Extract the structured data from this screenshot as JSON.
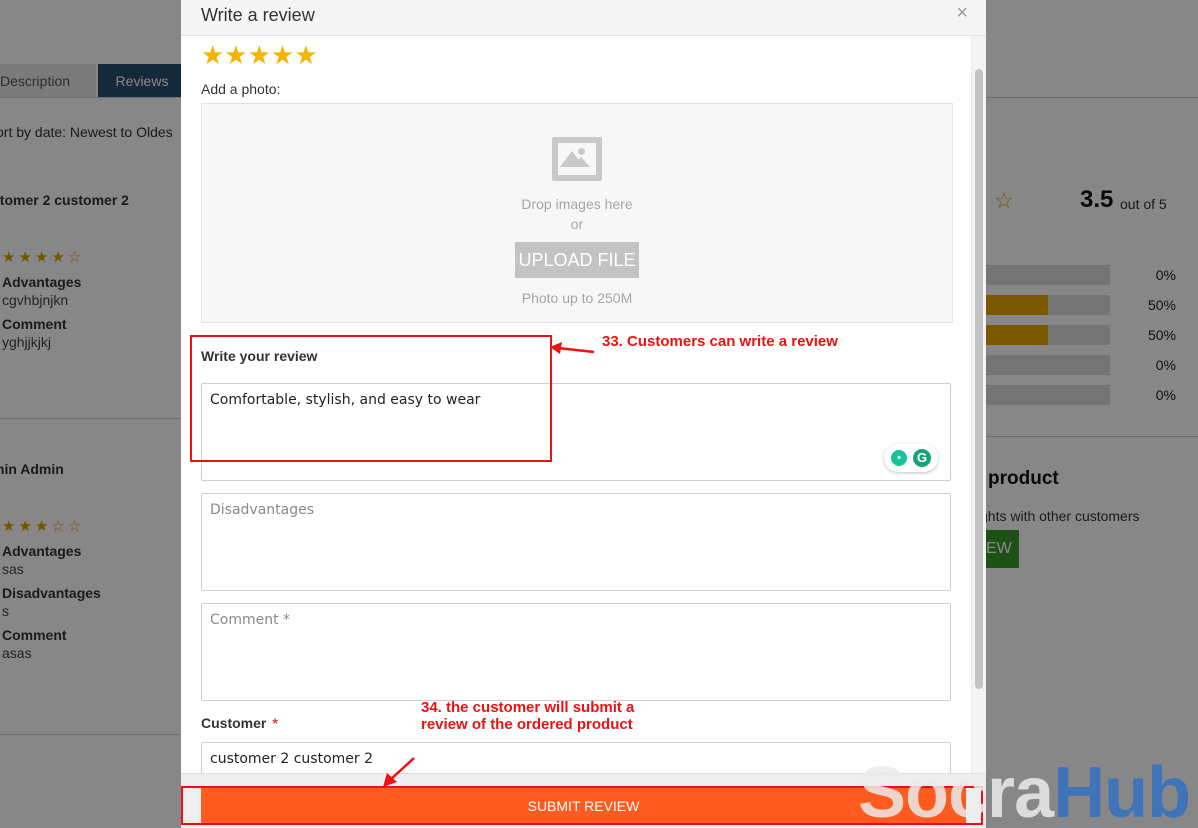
{
  "background": {
    "tabs": [
      "Description",
      "Reviews"
    ],
    "sort_label": "ort by date: Newest to Oldes",
    "reviews": [
      {
        "name": "stomer 2 customer 2",
        "rating": 4,
        "stars": "★★★★☆",
        "fields": [
          {
            "label": "Advantages",
            "value": "cgvhbjnjkn"
          },
          {
            "label": "Comment",
            "value": "yghjjkjkj"
          }
        ]
      },
      {
        "name": "min Admin",
        "rating": 3,
        "stars": "★★★☆☆",
        "fields": [
          {
            "label": "Advantages",
            "value": "sas"
          },
          {
            "label": "Disadvantages",
            "value": "s"
          },
          {
            "label": "Comment",
            "value": "asas"
          }
        ]
      }
    ],
    "summary": {
      "star_icon": "☆",
      "score": "3.5",
      "out_of": "out of 5",
      "bars": [
        {
          "pct": "0%",
          "fill": 0
        },
        {
          "pct": "50%",
          "fill": 0.5
        },
        {
          "pct": "50%",
          "fill": 0.5
        },
        {
          "pct": "0%",
          "fill": 0
        },
        {
          "pct": "0%",
          "fill": 0
        }
      ]
    },
    "product_heading": "product",
    "share_text": "ghts with other customers",
    "green_button": "EW"
  },
  "modal": {
    "title": "Write a review",
    "close": "×",
    "rating": 5,
    "stars": "★★★★★",
    "photo_label": "Add a photo:",
    "dropzone": {
      "drop_text": "Drop images here",
      "or_text": "or",
      "upload_label": "UPLOAD FILE",
      "limit_text": "Photo up to 250M"
    },
    "review_label": "Write your review",
    "review_value": "Comfortable, stylish, and easy to wear",
    "disadvantages_placeholder": "Disadvantages",
    "comment_placeholder": "Comment *",
    "customer_label": "Customer",
    "customer_required": "*",
    "customer_value": "customer 2 customer 2",
    "submit_label": "SUBMIT REVIEW"
  },
  "annotations": {
    "note_33": "33. Customers can write a review",
    "note_34_line1": "34. the customer will submit a",
    "note_34_line2": "review of the ordered product"
  },
  "watermark": {
    "part1": "Socra",
    "part2": "Hub"
  },
  "colors": {
    "accent": "#ff5a1f",
    "annotation": "#e11",
    "star": "#f5b400",
    "tab_active": "#2a4e6f"
  }
}
